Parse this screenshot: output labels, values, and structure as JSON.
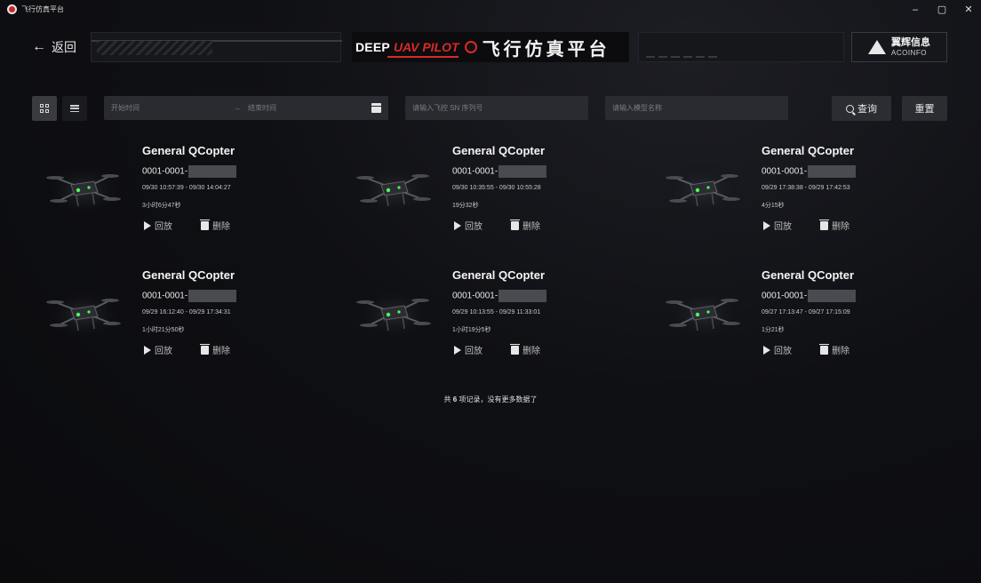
{
  "window": {
    "title": "飞行仿真平台",
    "controls": [
      "–",
      "▢",
      "✕"
    ]
  },
  "header": {
    "back_label": "返回",
    "banner_en_1": "DEEP",
    "banner_en_2": "UAV PILOT",
    "banner_cn": "飞行仿真平台",
    "brand_cn": "翼辉信息",
    "brand_en": "ACOINFO"
  },
  "filters": {
    "start_placeholder": "开始时间",
    "range_separator": "→",
    "end_placeholder": "结束时间",
    "sn_placeholder": "请输入飞控 SN 序列号",
    "name_placeholder": "请输入模型名称",
    "query_label": "查询",
    "reset_label": "重置"
  },
  "records": [
    {
      "title": "General QCopter",
      "sn": "0001-0001-",
      "time": "09/30 10:57:39 - 09/30 14:04:27",
      "duration": "3小时6分47秒",
      "play": "回放",
      "delete": "删除"
    },
    {
      "title": "General QCopter",
      "sn": "0001-0001-",
      "time": "09/30 10:35:55 - 09/30 10:55:28",
      "duration": "19分32秒",
      "play": "回放",
      "delete": "删除"
    },
    {
      "title": "General QCopter",
      "sn": "0001-0001-",
      "time": "09/29 17:38:38 - 09/29 17:42:53",
      "duration": "4分15秒",
      "play": "回放",
      "delete": "删除"
    },
    {
      "title": "General QCopter",
      "sn": "0001-0001-",
      "time": "09/29 16:12:40 - 09/29 17:34:31",
      "duration": "1小时21分50秒",
      "play": "回放",
      "delete": "删除"
    },
    {
      "title": "General QCopter",
      "sn": "0001-0001-",
      "time": "09/29 10:13:55 - 09/29 11:33:01",
      "duration": "1小时19分5秒",
      "play": "回放",
      "delete": "删除"
    },
    {
      "title": "General QCopter",
      "sn": "0001-0001-",
      "time": "09/27 17:13:47 - 09/27 17:15:09",
      "duration": "1分21秒",
      "play": "回放",
      "delete": "删除"
    }
  ],
  "footer": {
    "prefix": "共",
    "count": "6",
    "suffix": "项记录，没有更多数据了"
  },
  "colors": {
    "background": "#0f1014",
    "field": "#2a2b30",
    "accent_red": "#d82a2a",
    "drone_led": "#4cff5a"
  }
}
